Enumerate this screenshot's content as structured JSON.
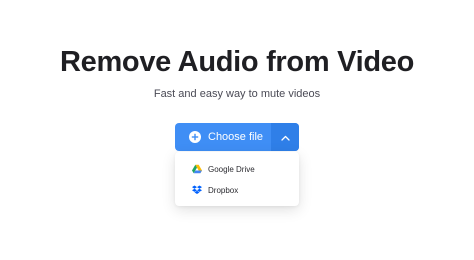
{
  "header": {
    "title": "Remove Audio from Video",
    "subtitle": "Fast and easy way to mute videos"
  },
  "upload": {
    "choose_label": "Choose file",
    "button_color": "#3f8ef5",
    "caret_color": "#2f7fe8",
    "icons": {
      "plus": "plus-circle-icon",
      "caret": "chevron-up-icon"
    }
  },
  "dropdown": {
    "items": [
      {
        "label": "Google Drive",
        "icon": "google-drive-icon"
      },
      {
        "label": "Dropbox",
        "icon": "dropbox-icon"
      }
    ]
  }
}
